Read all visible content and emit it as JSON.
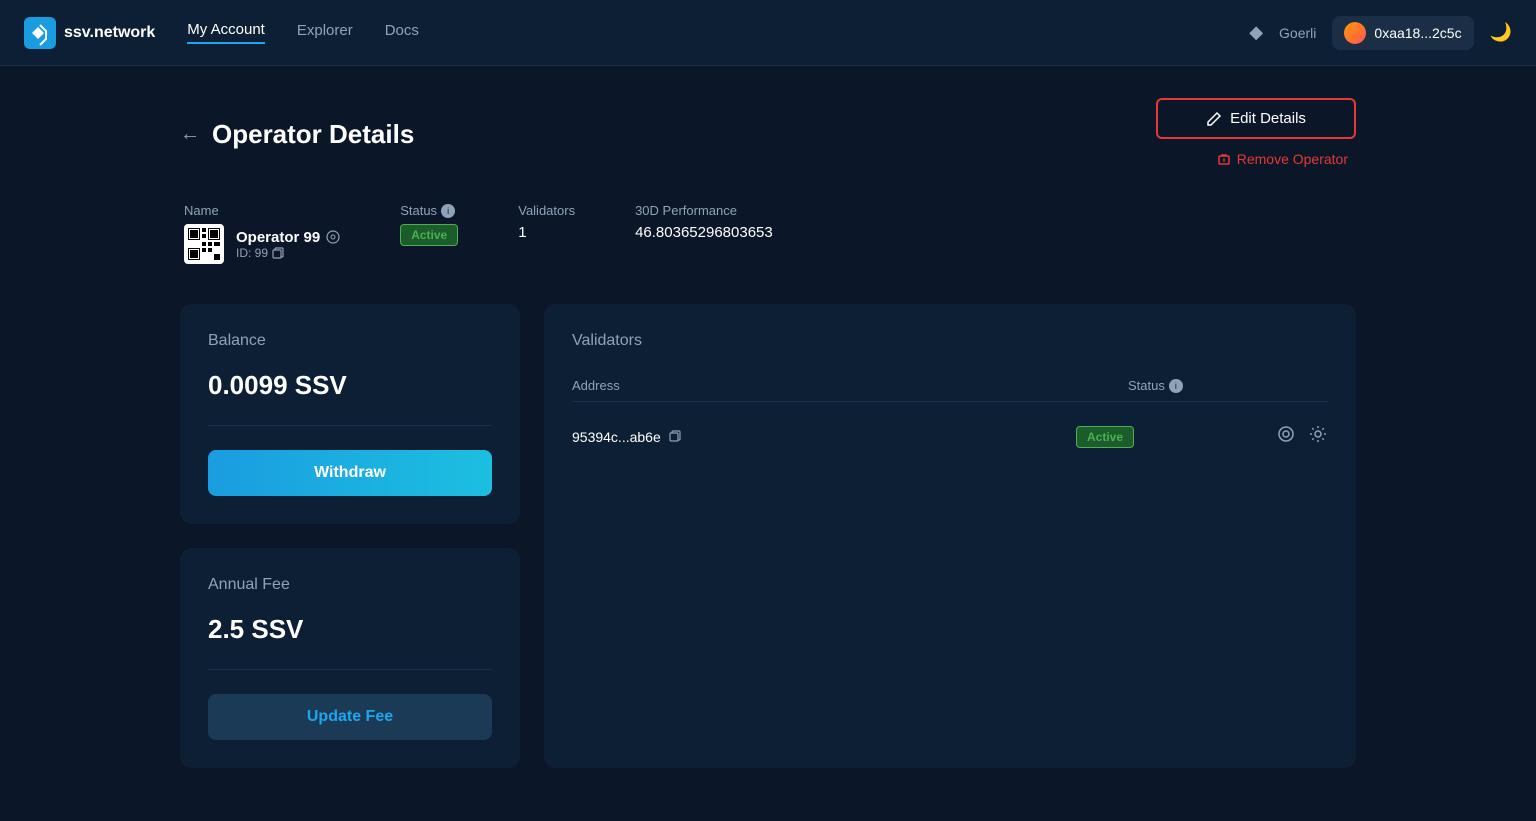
{
  "app": {
    "logo_text": "ssv.network",
    "nav": {
      "my_account": "My Account",
      "explorer": "Explorer",
      "docs": "Docs"
    },
    "network": "Goerli",
    "wallet_address": "0xaa18...2c5c",
    "theme_icon": "🌙"
  },
  "page": {
    "back_label": "←",
    "title": "Operator Details",
    "edit_btn": "Edit Details",
    "remove_btn": "Remove Operator"
  },
  "operator": {
    "name_label": "Name",
    "name": "Operator 99",
    "id": "ID: 99",
    "status_label": "Status",
    "status": "Active",
    "validators_label": "Validators",
    "validators_count": "1",
    "performance_label": "30D Performance",
    "performance_value": "46.80365296803653"
  },
  "balance_card": {
    "title": "Balance",
    "value": "0.0099 SSV",
    "withdraw_btn": "Withdraw"
  },
  "annual_fee_card": {
    "title": "Annual Fee",
    "value": "2.5 SSV",
    "update_btn": "Update Fee"
  },
  "validators_card": {
    "title": "Validators",
    "address_col": "Address",
    "status_col": "Status",
    "rows": [
      {
        "address": "95394c...ab6e",
        "status": "Active"
      }
    ]
  }
}
